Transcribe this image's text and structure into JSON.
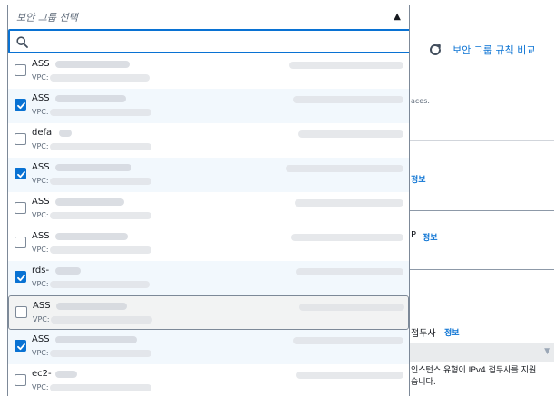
{
  "select": {
    "placeholder": "보안 그룹 선택",
    "search_value": ""
  },
  "background": {
    "compare_link": "보안 그룹 규칙 비교",
    "aces_fragment": "aces.",
    "info_1": "정보",
    "p_fragment": "P",
    "info_2": "정보",
    "adapter_label": "접두사",
    "info_3": "정보",
    "desc_line1": "인스턴스 유형이 IPv4 접두사를 지원",
    "desc_line2": "습니다."
  },
  "options": [
    {
      "name": "ASS",
      "vpc": "VPC:",
      "checked": false
    },
    {
      "name": "ASS",
      "vpc": "VPC:",
      "checked": true
    },
    {
      "name": "defa",
      "vpc": "VPC:",
      "checked": false
    },
    {
      "name": "ASS",
      "vpc": "VPC:",
      "checked": true
    },
    {
      "name": "ASS",
      "vpc": "VPC:",
      "checked": false
    },
    {
      "name": "ASS",
      "vpc": "VPC:",
      "checked": false
    },
    {
      "name": "rds-",
      "vpc": "VPC:",
      "checked": true
    },
    {
      "name": "ASS",
      "vpc": "VPC:",
      "checked": false,
      "focused": true
    },
    {
      "name": "ASS",
      "vpc": "VPC:",
      "checked": true
    },
    {
      "name": "ec2-",
      "vpc": "VPC:",
      "checked": false
    }
  ],
  "colors": {
    "accent": "#0972d3",
    "checked_row_bg": "#f2f8fd",
    "focused_row_bg": "#f2f3f3"
  }
}
